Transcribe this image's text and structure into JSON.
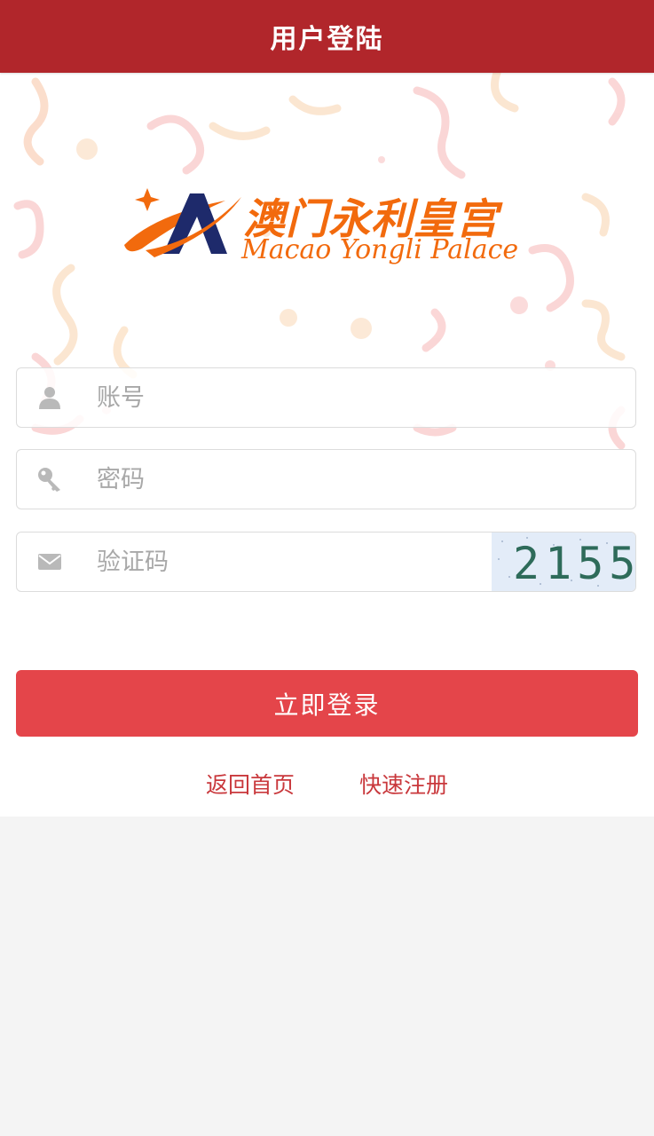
{
  "header": {
    "title": "用户登陆"
  },
  "logo": {
    "brand_cn": "澳门永利皇宫",
    "brand_en": "Macao Yongli Palace",
    "icon_name": "logo-a-icon",
    "brand_color": "#f26a0d",
    "mark_color": "#1e2a6b"
  },
  "form": {
    "account": {
      "placeholder": "账号",
      "value": "",
      "icon": "user-icon"
    },
    "password": {
      "placeholder": "密码",
      "value": "",
      "icon": "key-icon"
    },
    "captcha": {
      "placeholder": "验证码",
      "value": "",
      "icon": "envelope-icon",
      "image_code": "2155"
    },
    "submit_label": "立即登录"
  },
  "links": {
    "back_home": "返回首页",
    "quick_register": "快速注册"
  },
  "colors": {
    "header_bg": "#b1262b",
    "button_bg": "#e4454a",
    "link_color": "#c9383c",
    "page_bg": "#f4f4f4"
  }
}
